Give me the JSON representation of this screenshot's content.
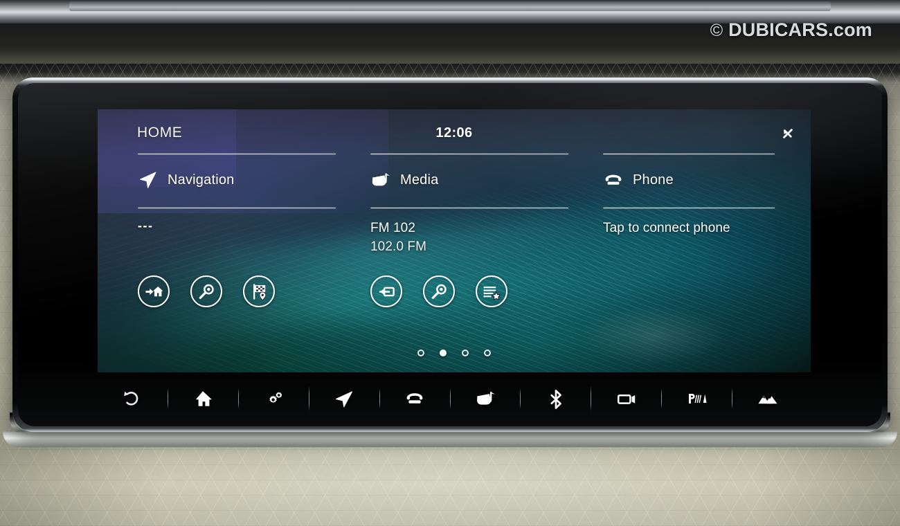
{
  "watermark": {
    "copyright": "©",
    "brand": "DUBICARS",
    "tld": ".com"
  },
  "screen": {
    "header": {
      "home_tab": "HOME",
      "clock": "12:06",
      "connection_icon": "disconnected-icon"
    },
    "panels": [
      {
        "id": "navigation",
        "icon": "navigation-arrow-icon",
        "label": "Navigation",
        "line1": "---",
        "line2": "",
        "shortcuts": [
          {
            "icon": "go-home-icon",
            "name": "nav-shortcut-go-home"
          },
          {
            "icon": "search-icon",
            "name": "nav-shortcut-search"
          },
          {
            "icon": "destination-flag-icon",
            "name": "nav-shortcut-destinations"
          }
        ]
      },
      {
        "id": "media",
        "icon": "media-clapperboard-note-icon",
        "label": "Media",
        "line1": "FM 102",
        "line2": "102.0 FM",
        "shortcuts": [
          {
            "icon": "source-input-icon",
            "name": "media-shortcut-source"
          },
          {
            "icon": "search-icon",
            "name": "media-shortcut-search"
          },
          {
            "icon": "favorites-list-icon",
            "name": "media-shortcut-favorites"
          }
        ]
      },
      {
        "id": "phone",
        "icon": "telephone-icon",
        "label": "Phone",
        "line1": "Tap to connect phone",
        "line2": "",
        "shortcuts": []
      }
    ],
    "pagination": {
      "total": 4,
      "active": 2
    },
    "bottom_bar": [
      {
        "icon": "back-arrow-icon",
        "name": "bottombar-back"
      },
      {
        "icon": "home-icon",
        "name": "bottombar-home"
      },
      {
        "icon": "settings-gears-icon",
        "name": "bottombar-settings"
      },
      {
        "icon": "navigation-arrow-icon",
        "name": "bottombar-navigation"
      },
      {
        "icon": "telephone-icon",
        "name": "bottombar-phone"
      },
      {
        "icon": "media-clapperboard-note-icon",
        "name": "bottombar-media"
      },
      {
        "icon": "bluetooth-icon",
        "name": "bottombar-bluetooth"
      },
      {
        "icon": "camera-icon",
        "name": "bottombar-camera"
      },
      {
        "icon": "park-assist-icon",
        "name": "bottombar-park-assist"
      },
      {
        "icon": "terrain-offroad-icon",
        "name": "bottombar-terrain"
      }
    ]
  },
  "colors": {
    "accent_teal": "#2bbfc0",
    "screen_blue": "#1c2138",
    "text_white": "#ffffff",
    "tab_purple": "#464aaa"
  }
}
